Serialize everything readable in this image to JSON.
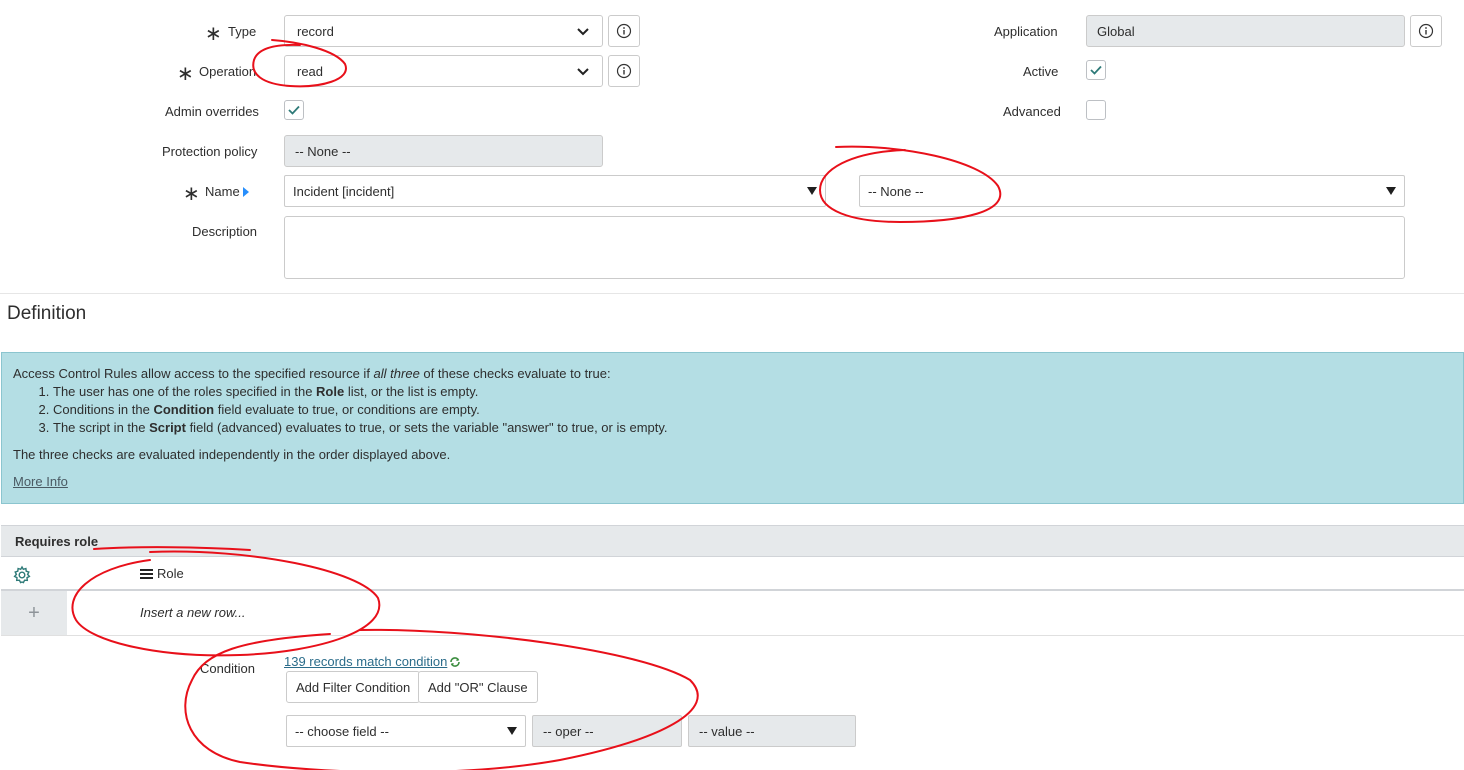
{
  "form": {
    "type": {
      "label": "Type",
      "value": "record"
    },
    "operation": {
      "label": "Operation",
      "value": "read"
    },
    "admin_overrides": {
      "label": "Admin overrides",
      "checked": true
    },
    "protection_policy": {
      "label": "Protection policy",
      "value": "-- None --"
    },
    "name": {
      "label": "Name",
      "table_value": "Incident [incident]",
      "field_value": "-- None --"
    },
    "description": {
      "label": "Description",
      "value": ""
    },
    "application": {
      "label": "Application",
      "value": "Global"
    },
    "active": {
      "label": "Active",
      "checked": true
    },
    "advanced": {
      "label": "Advanced",
      "checked": false
    }
  },
  "definition": {
    "title": "Definition",
    "intro_pre": "Access Control Rules allow access to the specified resource if ",
    "intro_em": "all three",
    "intro_post": " of these checks evaluate to true:",
    "items": [
      {
        "pre": "The user has one of the roles specified in the ",
        "bold": "Role",
        "post": " list, or the list is empty."
      },
      {
        "pre": "Conditions in the ",
        "bold": "Condition",
        "post": " field evaluate to true, or conditions are empty."
      },
      {
        "pre": "The script in the ",
        "bold": "Script",
        "post": " field (advanced) evaluates to true, or sets the variable \"answer\" to true, or is empty."
      }
    ],
    "footer": "The three checks are evaluated independently in the order displayed above.",
    "more_info": "More Info"
  },
  "requires_role": {
    "title": "Requires role",
    "column": "Role",
    "insert_row": "Insert a new row..."
  },
  "condition": {
    "label": "Condition",
    "match_link": "139 records match condition",
    "add_filter": "Add Filter Condition",
    "add_or": "Add \"OR\" Clause",
    "field_placeholder": "-- choose field --",
    "oper_placeholder": "-- oper --",
    "value_placeholder": "-- value --"
  },
  "colors": {
    "annotation": "#e8101a",
    "info_bg": "#b4dee4",
    "check": "#2e7a78"
  }
}
